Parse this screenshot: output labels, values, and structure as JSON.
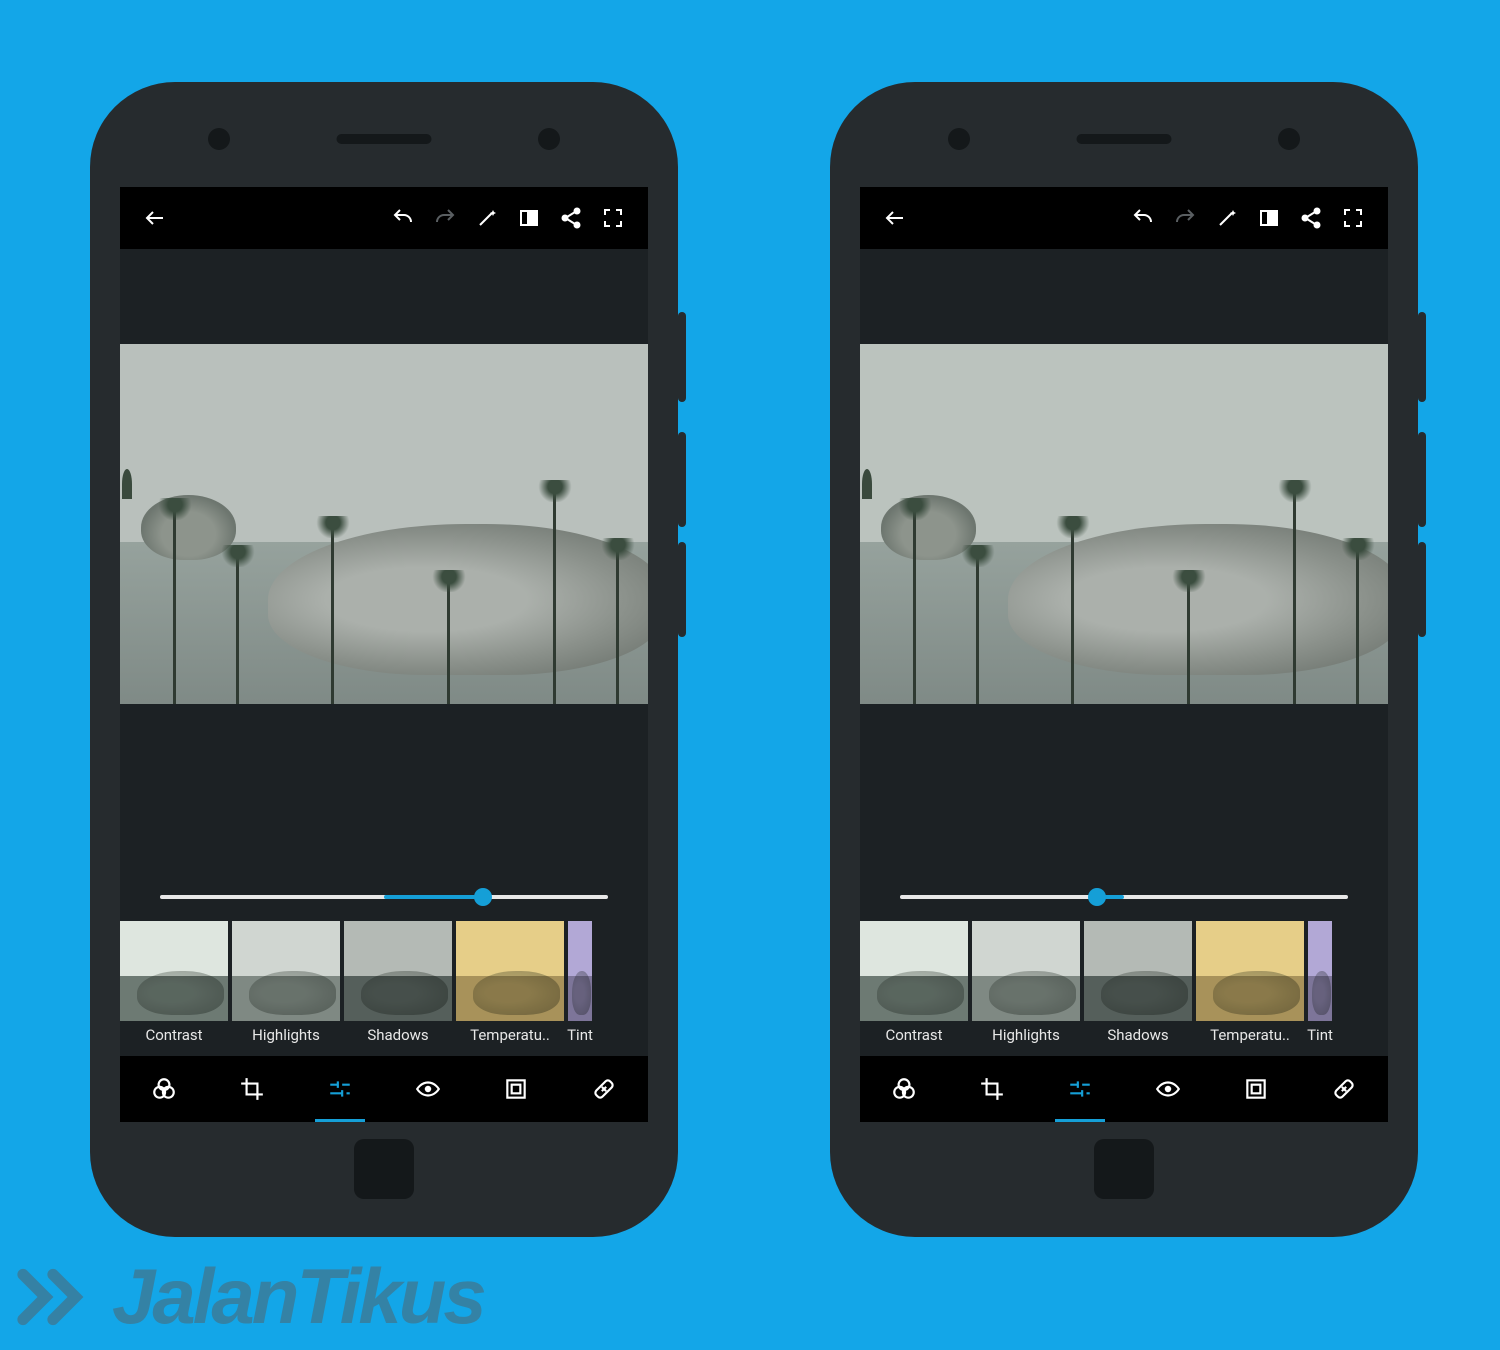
{
  "colors": {
    "accent": "#159FD7",
    "page_bg": "#13A6E8"
  },
  "watermark": "JalanTikus",
  "toolbar": {
    "back": "back",
    "undo": "undo",
    "redo": "redo",
    "auto": "auto-enhance",
    "compare": "compare",
    "share": "share",
    "fullscreen": "fullscreen"
  },
  "adjustments": [
    {
      "id": "contrast",
      "label": "Contrast"
    },
    {
      "id": "highlights",
      "label": "Highlights"
    },
    {
      "id": "shadows",
      "label": "Shadows"
    },
    {
      "id": "temperature",
      "label": "Temperatu.."
    },
    {
      "id": "tint",
      "label": "Tint"
    }
  ],
  "bottom_nav": [
    {
      "id": "looks",
      "active": false
    },
    {
      "id": "crop",
      "active": false
    },
    {
      "id": "adjust",
      "active": true
    },
    {
      "id": "redeye",
      "active": false
    },
    {
      "id": "frames",
      "active": false
    },
    {
      "id": "heal",
      "active": false
    }
  ],
  "phones": [
    {
      "side": "left",
      "slider_percent": 72,
      "fill_from": 50,
      "fill_to": 72
    },
    {
      "side": "right",
      "slider_percent": 44,
      "fill_from": 44,
      "fill_to": 50
    }
  ]
}
